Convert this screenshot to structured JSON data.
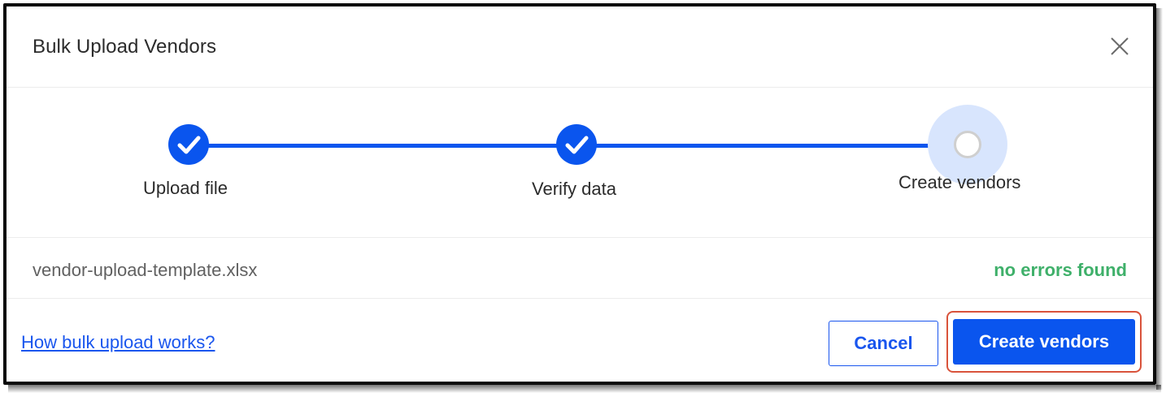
{
  "dialog": {
    "title": "Bulk Upload Vendors",
    "close_icon": "close-icon"
  },
  "stepper": {
    "steps": [
      {
        "label": "Upload file",
        "state": "completed",
        "icon": "check-icon"
      },
      {
        "label": "Verify data",
        "state": "completed",
        "icon": "check-icon"
      },
      {
        "label": "Create vendors",
        "state": "current",
        "icon": "step-indicator-icon"
      }
    ]
  },
  "file": {
    "name": "vendor-upload-template.xlsx",
    "status": "no errors found"
  },
  "footer": {
    "help_link": "How bulk upload works?",
    "cancel_label": "Cancel",
    "create_label": "Create vendors"
  },
  "colors": {
    "accent": "#0a55ee",
    "success": "#3fb06a",
    "highlight_outline": "#d9533b",
    "current_step_halo": "#d8e5fd"
  }
}
